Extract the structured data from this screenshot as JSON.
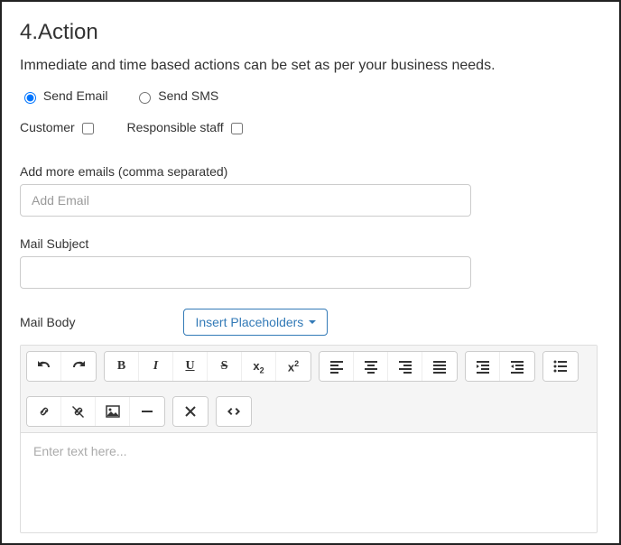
{
  "section": {
    "title": "4.Action",
    "subtitle": "Immediate and time based actions can be set as per your business needs."
  },
  "action_type": {
    "email_label": "Send Email",
    "sms_label": "Send SMS",
    "selected": "email"
  },
  "recipients": {
    "customer_label": "Customer",
    "staff_label": "Responsible staff"
  },
  "extra_emails": {
    "label": "Add more emails (comma separated)",
    "placeholder": "Add Email",
    "value": ""
  },
  "mail_subject": {
    "label": "Mail Subject",
    "value": ""
  },
  "mail_body": {
    "label": "Mail Body",
    "insert_btn": "Insert Placeholders",
    "editor_placeholder": "Enter text here..."
  }
}
